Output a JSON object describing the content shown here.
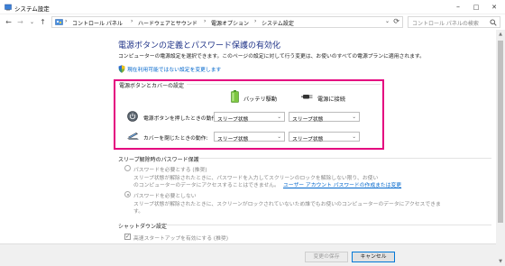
{
  "window": {
    "title": "システム設定",
    "minimize": "–",
    "maximize": "□",
    "close": "✕"
  },
  "nav": {
    "back": "←",
    "forward": "→",
    "dropdown": "⌄",
    "up": "↑"
  },
  "address": {
    "crumbs": [
      "コントロール パネル",
      "ハードウェアとサウンド",
      "電源オプション",
      "システム設定"
    ],
    "separator": "›",
    "lead": "›",
    "refresh": "⟳",
    "dropdown": "⌄"
  },
  "search": {
    "placeholder": "コントロール パネルの検索"
  },
  "page": {
    "title": "電源ボタンの定義とパスワード保護の有効化",
    "description": "コンピューターの電源設定を選択できます。このページの設定に対して行う変更は、お使いのすべての電源プランに適用されます。",
    "uac_link": "現在利用可能ではない設定を変更します"
  },
  "power_section": {
    "heading": "電源ボタンとカバーの設定",
    "col_battery": "バッテリ駆動",
    "col_plugged": "電源に接続",
    "rows": [
      {
        "label": "電源ボタンを押したときの動作:",
        "battery": "スリープ状態",
        "plugged": "スリープ状態"
      },
      {
        "label": "カバーを閉じたときの動作:",
        "battery": "スリープ状態",
        "plugged": "スリープ状態"
      }
    ]
  },
  "password_section": {
    "heading": "スリープ解除時のパスワード保護",
    "option1_label": "パスワードを必要とする (推奨)",
    "option1_desc1": "スリープ状態が解除されたときに、パスワードを入力してスクリーンのロックを解除しない限り、お使い",
    "option1_desc2": "のコンピューターのデータにアクセスすることはできません。",
    "option1_link": "ユーザー アカウント パスワードの作成または変更",
    "option2_label": "パスワードを必要としない",
    "option2_desc1": "スリープ状態が解除されたときに、スクリーンがロックされていないため誰でもお使いのコンピューターのデータにアクセスできま",
    "option2_desc2": "す。"
  },
  "shutdown_section": {
    "heading": "シャットダウン設定",
    "fast_startup": "高速スタートアップを有効にする (推奨)",
    "fast_startup_checked": "✓"
  },
  "footer": {
    "save": "変更の保存",
    "cancel": "キャンセル"
  },
  "scrollbar": {
    "up": "▲",
    "down": "▼"
  },
  "colors": {
    "accent_title": "#1e3287",
    "link": "#0066cc",
    "highlight": "#e4007f"
  },
  "icons": [
    "power-options-icon",
    "uac-shield-icon",
    "battery-icon",
    "plug-icon",
    "power-button-icon",
    "laptop-lid-icon",
    "search-icon"
  ]
}
